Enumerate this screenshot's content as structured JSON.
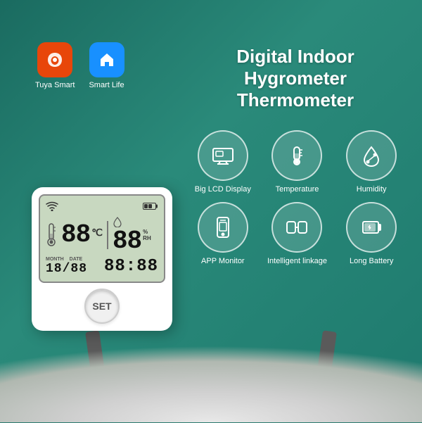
{
  "background": {
    "color": "#2a7a6e"
  },
  "apps": [
    {
      "name": "Tuya Smart",
      "label": "Tuya Smart",
      "bg_color": "#e8460a",
      "icon": "🔥"
    },
    {
      "name": "Smart Life",
      "label": "Smart Life",
      "bg_color": "#1890ff",
      "icon": "🏠"
    }
  ],
  "product_title": {
    "line1": "Digital Indoor",
    "line2": "Hygrometer Thermometer"
  },
  "features": [
    {
      "id": "big-lcd",
      "label": "Big LCD Display",
      "icon": "lcd"
    },
    {
      "id": "temperature",
      "label": "Temperature",
      "icon": "thermometer"
    },
    {
      "id": "humidity",
      "label": "Humidity",
      "icon": "drop"
    },
    {
      "id": "app-monitor",
      "label": "APP Monitor",
      "icon": "phone"
    },
    {
      "id": "intelligent-linkage",
      "label": "Intelligent linkage",
      "icon": "link"
    },
    {
      "id": "long-battery",
      "label": "Long Battery",
      "icon": "battery"
    }
  ],
  "device": {
    "temperature": "88",
    "temp_unit": "℃",
    "humidity": "88",
    "hum_unit": "%RH",
    "month": "18",
    "date": "88",
    "time": "88:88",
    "button_label": "SET"
  }
}
